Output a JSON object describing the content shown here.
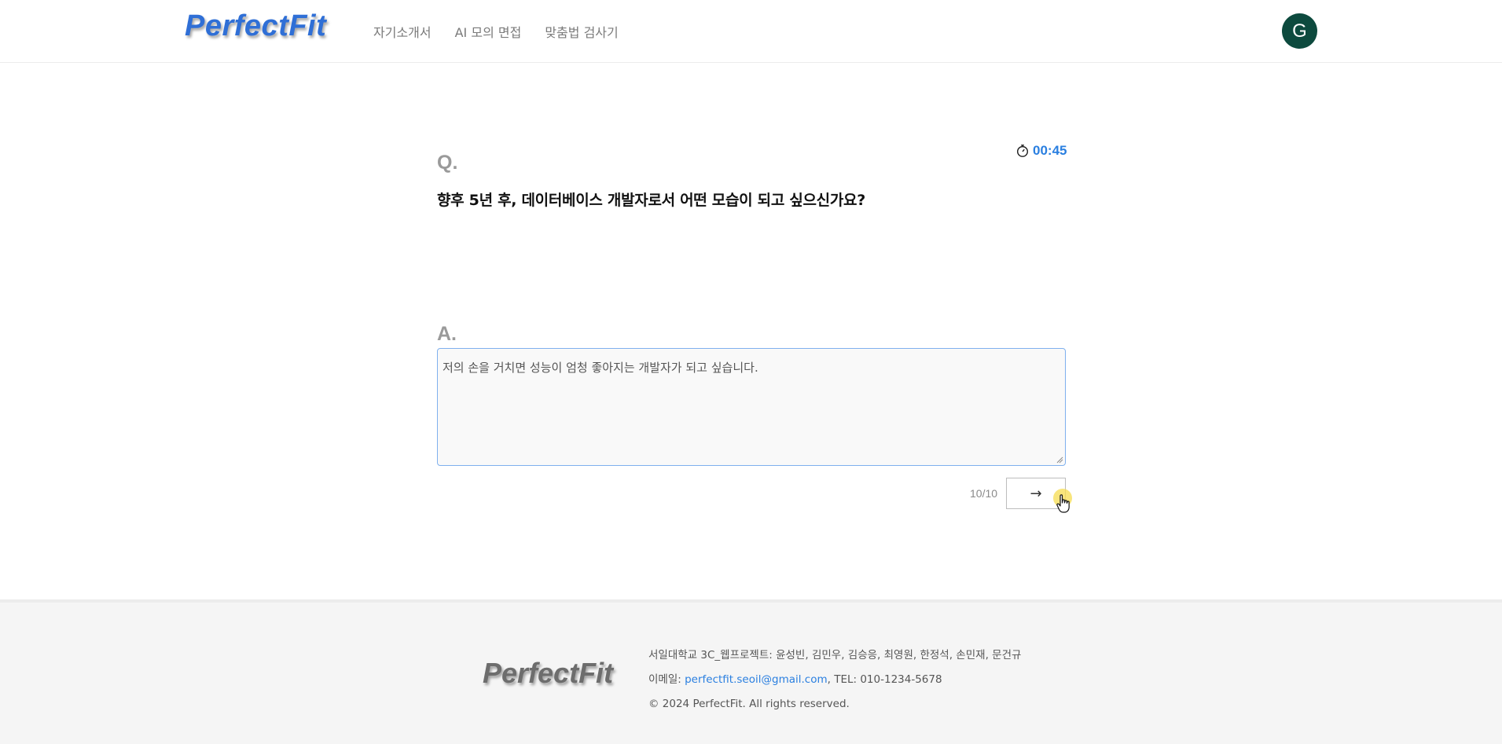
{
  "header": {
    "logo": "PerfectFit",
    "nav": [
      {
        "label": "자기소개서"
      },
      {
        "label": "AI 모의 면접"
      },
      {
        "label": "맞춤법 검사기"
      }
    ],
    "avatar_letter": "G"
  },
  "interview": {
    "q_label": "Q.",
    "timer": "00:45",
    "question": "향후 5년 후, 데이터베이스 개발자로서 어떤 모습이 되고 싶으신가요?",
    "a_label": "A.",
    "answer": "저의 손을 거치면 성능이 엄청 좋아지는 개발자가 되고 싶습니다.",
    "progress": "10/10",
    "next_label": "→"
  },
  "footer": {
    "logo": "PerfectFit",
    "credits": "서일대학교 3C_웹프로젝트: 윤성빈, 김민우, 김승응, 최영원, 한정석, 손민재, 문건규",
    "email_prefix": "이메일: ",
    "email": "perfectfit.seoil@gmail.com",
    "tel": ", TEL: 010-1234-5678",
    "copyright": "© 2024 PerfectFit. All rights reserved."
  },
  "colors": {
    "accent": "#2a7fe0",
    "logo_blue": "#2f6fd6",
    "avatar_bg": "#0d4a3e"
  },
  "icons": [
    "stopwatch-icon",
    "arrow-right-icon",
    "hand-pointer-icon"
  ]
}
